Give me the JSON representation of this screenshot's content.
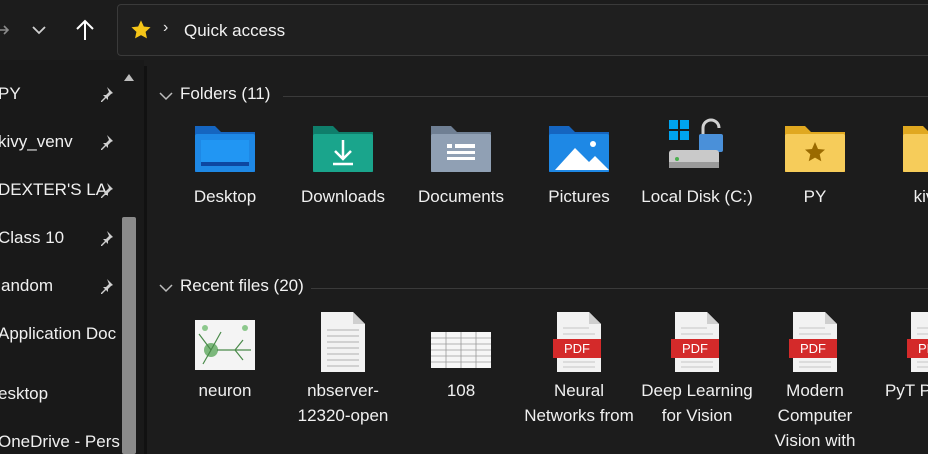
{
  "toolbar": {
    "back_dropdown_icon": "chevron-down-icon",
    "up_icon": "arrow-up-icon"
  },
  "address_bar": {
    "icon": "star-icon",
    "separator": "›",
    "location": "Quick access"
  },
  "sidebar": {
    "items": [
      {
        "label": "PY",
        "pinned": true
      },
      {
        "label": "kivy_venv",
        "pinned": true
      },
      {
        "label": "DEXTER'S LA",
        "pinned": true
      },
      {
        "label": "Class 10",
        "pinned": true
      },
      {
        "label": "andom",
        "pinned": true
      },
      {
        "label": "Application Doc",
        "pinned": false
      },
      {
        "label": "esktop",
        "pinned": false
      },
      {
        "label": "OneDrive - Pers",
        "pinned": false
      }
    ]
  },
  "folders_section": {
    "title": "Folders (11)",
    "items": [
      {
        "name": "Desktop",
        "icon": "desktop-folder-icon"
      },
      {
        "name": "Downloads",
        "icon": "downloads-folder-icon"
      },
      {
        "name": "Documents",
        "icon": "documents-folder-icon"
      },
      {
        "name": "Pictures",
        "icon": "pictures-folder-icon"
      },
      {
        "name": "Local Disk (C:)",
        "icon": "local-disk-icon"
      },
      {
        "name": "PY",
        "icon": "starred-folder-icon"
      },
      {
        "name": "kivy_",
        "icon": "folder-icon"
      }
    ]
  },
  "recent_section": {
    "title": "Recent files (20)",
    "items": [
      {
        "name": "neuron",
        "icon": "image-thumbnail-icon"
      },
      {
        "name": "nbserver-12320-open",
        "icon": "text-file-icon"
      },
      {
        "name": "108",
        "icon": "spreadsheet-thumbnail-icon"
      },
      {
        "name": "Neural Networks from",
        "icon": "pdf-icon"
      },
      {
        "name": "Deep Learning for Vision",
        "icon": "pdf-icon"
      },
      {
        "name": "Modern Computer Vision with",
        "icon": "pdf-icon"
      },
      {
        "name": "PyT Po Refe",
        "icon": "pdf-icon"
      }
    ],
    "pdf_badge": "PDF"
  },
  "colors": {
    "background": "#1c1c1c",
    "sidebar": "#191919",
    "pdf_red": "#d42a2a",
    "folder_blue": "#1e88d6",
    "folder_teal": "#1aa58c",
    "folder_yellow": "#f4c54a"
  }
}
